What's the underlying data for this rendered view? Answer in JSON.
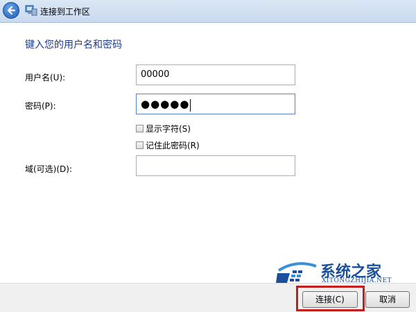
{
  "window": {
    "title": "连接到工作区"
  },
  "form": {
    "heading": "键入您的用户名和密码",
    "username_label": "用户名(U):",
    "username_value": "00000",
    "password_label": "密码(P):",
    "password_value": "●●●●●",
    "show_chars_label": "显示字符(S)",
    "remember_label": "记住此密码(R)",
    "domain_label": "域(可选)(D):",
    "domain_value": ""
  },
  "buttons": {
    "connect": "连接(C)",
    "cancel": "取消"
  },
  "watermark": {
    "title": "系统之家",
    "url": "XITONGZHIJIA.NET"
  },
  "colors": {
    "heading": "#1e3c8c",
    "highlight": "#c31d1d",
    "watermark": "#1b4f9c"
  }
}
